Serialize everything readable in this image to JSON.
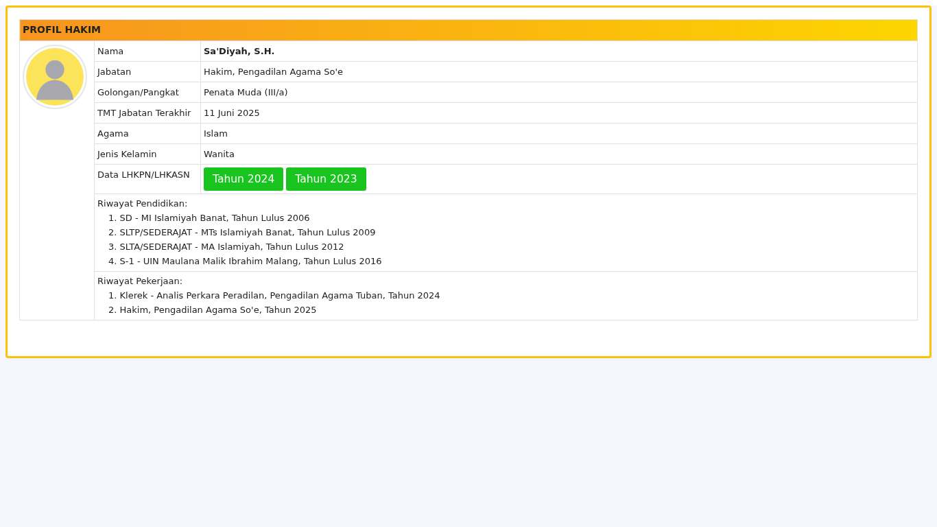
{
  "panel": {
    "title": "PROFIL HAKIM"
  },
  "fields": [
    {
      "kind": "text",
      "label": "Nama",
      "value": "Sa'Diyah, S.H.",
      "bold": true
    },
    {
      "kind": "text",
      "label": "Jabatan",
      "value": "Hakim, Pengadilan Agama So'e",
      "bold": false
    },
    {
      "kind": "text",
      "label": "Golongan/Pangkat",
      "value": "Penata Muda (III/a)",
      "bold": false
    },
    {
      "kind": "text",
      "label": "TMT Jabatan Terakhir",
      "value": "11 Juni 2025",
      "bold": false
    },
    {
      "kind": "text",
      "label": "Agama",
      "value": "Islam",
      "bold": false
    },
    {
      "kind": "text",
      "label": "Jenis Kelamin",
      "value": "Wanita",
      "bold": false
    },
    {
      "kind": "buttons",
      "label": "Data LHKPN/LHKASN",
      "buttons": [
        "Tahun 2024",
        "Tahun 2023"
      ]
    }
  ],
  "sections": [
    {
      "title": "Riwayat Pendidikan:",
      "items": [
        "1. SD - MI Islamiyah Banat, Tahun Lulus 2006",
        "2. SLTP/SEDERAJAT - MTs Islamiyah Banat, Tahun Lulus 2009",
        "3. SLTA/SEDERAJAT - MA Islamiyah, Tahun Lulus 2012",
        "4. S-1 - UIN Maulana Malik Ibrahim Malang, Tahun Lulus 2016"
      ]
    },
    {
      "title": "Riwayat Pekerjaan:",
      "items": [
        "1. Klerek - Analis Perkara Peradilan, Pengadilan Agama Tuban, Tahun 2024",
        "2. Hakim, Pengadilan Agama So'e, Tahun 2025"
      ]
    }
  ]
}
